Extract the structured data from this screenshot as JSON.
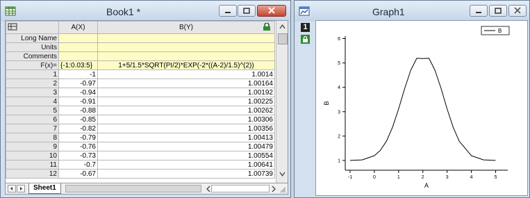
{
  "book": {
    "title": "Book1 *",
    "columns": [
      "A(X)",
      "B(Y)"
    ],
    "meta_rows": [
      {
        "label": "Long Name",
        "a": "",
        "b": ""
      },
      {
        "label": "Units",
        "a": "",
        "b": ""
      },
      {
        "label": "Comments",
        "a": "",
        "b": ""
      }
    ],
    "fx_label": "F(x)=",
    "fx_a": "{-1:0.03:5}",
    "fx_b": "1+5/1.5*SQRT(PI/2)*EXP(-2*((A-2)/1.5)^(2))",
    "rows": [
      {
        "n": "1",
        "a": "-1",
        "b": "1.0014"
      },
      {
        "n": "2",
        "a": "-0.97",
        "b": "1.00164"
      },
      {
        "n": "3",
        "a": "-0.94",
        "b": "1.00192"
      },
      {
        "n": "4",
        "a": "-0.91",
        "b": "1.00225"
      },
      {
        "n": "5",
        "a": "-0.88",
        "b": "1.00262"
      },
      {
        "n": "6",
        "a": "-0.85",
        "b": "1.00306"
      },
      {
        "n": "7",
        "a": "-0.82",
        "b": "1.00356"
      },
      {
        "n": "8",
        "a": "-0.79",
        "b": "1.00413"
      },
      {
        "n": "9",
        "a": "-0.76",
        "b": "1.00479"
      },
      {
        "n": "10",
        "a": "-0.73",
        "b": "1.00554"
      },
      {
        "n": "11",
        "a": "-0.7",
        "b": "1.00641"
      },
      {
        "n": "12",
        "a": "-0.67",
        "b": "1.00739"
      }
    ],
    "sheet_tab": "Sheet1",
    "colors": {
      "meta_bg": "#fdfcc4",
      "header_bg": "#e6e6e6",
      "close": "#c5462f"
    }
  },
  "graph": {
    "title": "Graph1",
    "layer_label": "1",
    "icons": [
      "worksheet-icon",
      "graph-icon",
      "lock-icon",
      "minimize-icon",
      "maximize-icon",
      "close-icon"
    ]
  },
  "chart_data": {
    "type": "line",
    "title": "",
    "xlabel": "A",
    "ylabel": "B",
    "xlim": [
      -1.2,
      5.5
    ],
    "ylim": [
      0.6,
      6.1
    ],
    "xticks": [
      -1,
      0,
      1,
      2,
      3,
      4,
      5
    ],
    "yticks": [
      1,
      2,
      3,
      4,
      5,
      6
    ],
    "legend": "top-right",
    "series": [
      {
        "name": "B",
        "color": "#000000",
        "x": [
          -1,
          -0.5,
          0,
          0.25,
          0.5,
          0.75,
          1,
          1.25,
          1.5,
          1.75,
          2,
          2.25,
          2.5,
          2.75,
          3,
          3.25,
          3.5,
          4,
          4.5,
          5
        ],
        "y": [
          1.0014,
          1.024,
          1.195,
          1.416,
          1.79,
          2.36,
          3.11,
          3.95,
          4.7,
          5.19,
          5.18,
          5.19,
          4.7,
          3.95,
          3.11,
          2.36,
          1.79,
          1.195,
          1.024,
          1.0014
        ]
      }
    ]
  }
}
